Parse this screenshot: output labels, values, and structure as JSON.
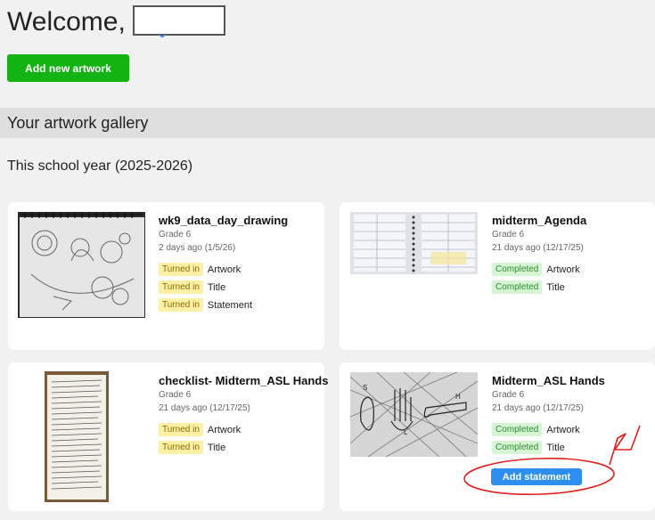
{
  "header": {
    "welcome": "Welcome,",
    "add_artwork_label": "Add new artwork"
  },
  "gallery": {
    "heading": "Your artwork gallery",
    "year_label": "This school year (2025-2026)"
  },
  "cards": [
    {
      "title": "wk9_data_day_drawing",
      "grade": "Grade 6",
      "date": "2 days ago (1/5/26)",
      "statuses": [
        {
          "badge": "Turned in",
          "label": "Artwork",
          "kind": "turned"
        },
        {
          "badge": "Turned in",
          "label": "Title",
          "kind": "turned"
        },
        {
          "badge": "Turned in",
          "label": "Statement",
          "kind": "turned"
        }
      ]
    },
    {
      "title": "midterm_Agenda",
      "grade": "Grade 6",
      "date": "21 days ago (12/17/25)",
      "statuses": [
        {
          "badge": "Completed",
          "label": "Artwork",
          "kind": "completed"
        },
        {
          "badge": "Completed",
          "label": "Title",
          "kind": "completed"
        }
      ]
    },
    {
      "title": "checklist- Midterm_ASL Hands",
      "grade": "Grade 6",
      "date": "21 days ago (12/17/25)",
      "statuses": [
        {
          "badge": "Turned in",
          "label": "Artwork",
          "kind": "turned"
        },
        {
          "badge": "Turned in",
          "label": "Title",
          "kind": "turned"
        }
      ]
    },
    {
      "title": "Midterm_ASL Hands",
      "grade": "Grade 6",
      "date": "21 days ago (12/17/25)",
      "statuses": [
        {
          "badge": "Completed",
          "label": "Artwork",
          "kind": "completed"
        },
        {
          "badge": "Completed",
          "label": "Title",
          "kind": "completed"
        }
      ],
      "action_label": "Add statement"
    }
  ],
  "colors": {
    "primary_green": "#12b312",
    "action_blue": "#2e8ff0",
    "turned_in_bg": "#fbf0a6",
    "completed_bg": "#d5f5d5",
    "annotation_red": "#e02020"
  }
}
